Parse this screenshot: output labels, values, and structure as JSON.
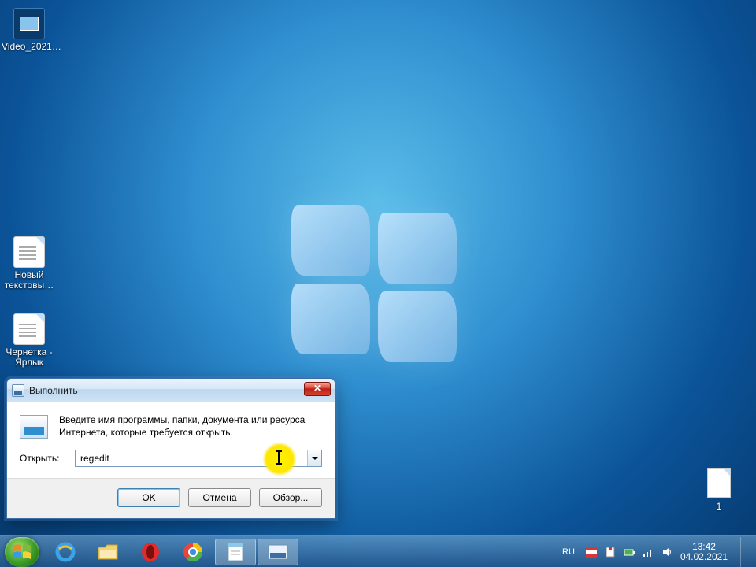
{
  "desktop": {
    "icons": [
      {
        "label": "Video_2021…"
      },
      {
        "label": "Новый текстовы…"
      },
      {
        "label": "Чернетка - Ярлык"
      }
    ],
    "right_file_label": "1"
  },
  "run_dialog": {
    "title": "Выполнить",
    "description": "Введите имя программы, папки, документа или ресурса Интернета, которые требуется открыть.",
    "open_label": "Открыть:",
    "input_value": "regedit",
    "buttons": {
      "ok": "OK",
      "cancel": "Отмена",
      "browse": "Обзор..."
    }
  },
  "taskbar": {
    "tray": {
      "language": "RU",
      "time": "13:42",
      "date": "04.02.2021"
    }
  }
}
